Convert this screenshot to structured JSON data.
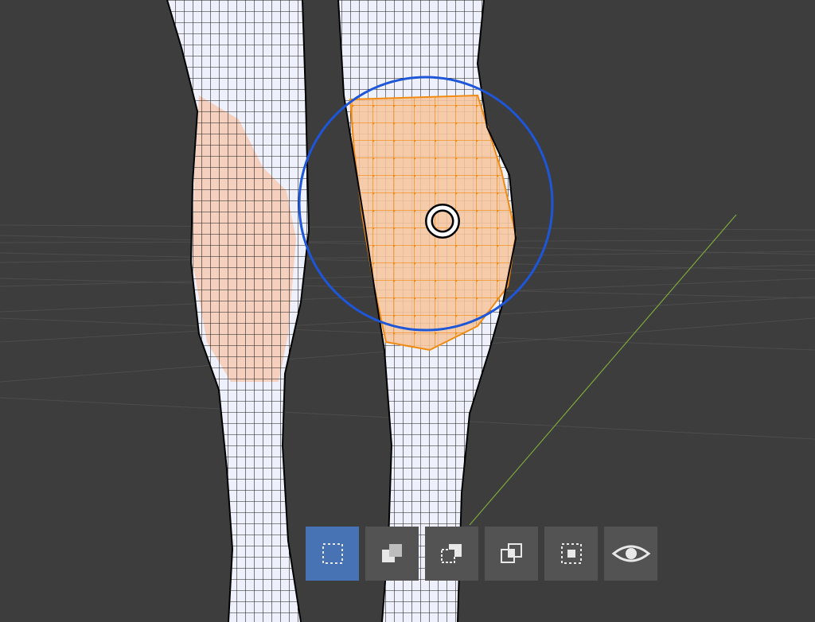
{
  "viewport": {
    "background": "#3d3d3d",
    "mode": "edit-mode-circle-select",
    "colors": {
      "mesh_wire": "#000000",
      "selected_wire": "#ff8a00",
      "skin": "#f5d0bf",
      "sock": "#eef1fb",
      "brush_circle": "#1e56d8",
      "y_axis": "#7da83a"
    }
  },
  "toolbar": {
    "active_index": 0,
    "buttons": [
      {
        "name": "select-box-set-button",
        "icon": "dashed-box-icon"
      },
      {
        "name": "select-extend-button",
        "icon": "union-squares-icon"
      },
      {
        "name": "select-subtract-button",
        "icon": "subtract-squares-icon"
      },
      {
        "name": "select-intersect-button",
        "icon": "intersect-squares-icon"
      },
      {
        "name": "select-invert-button",
        "icon": "invert-squares-icon"
      },
      {
        "name": "toggle-xray-button",
        "icon": "eye-icon"
      }
    ]
  }
}
